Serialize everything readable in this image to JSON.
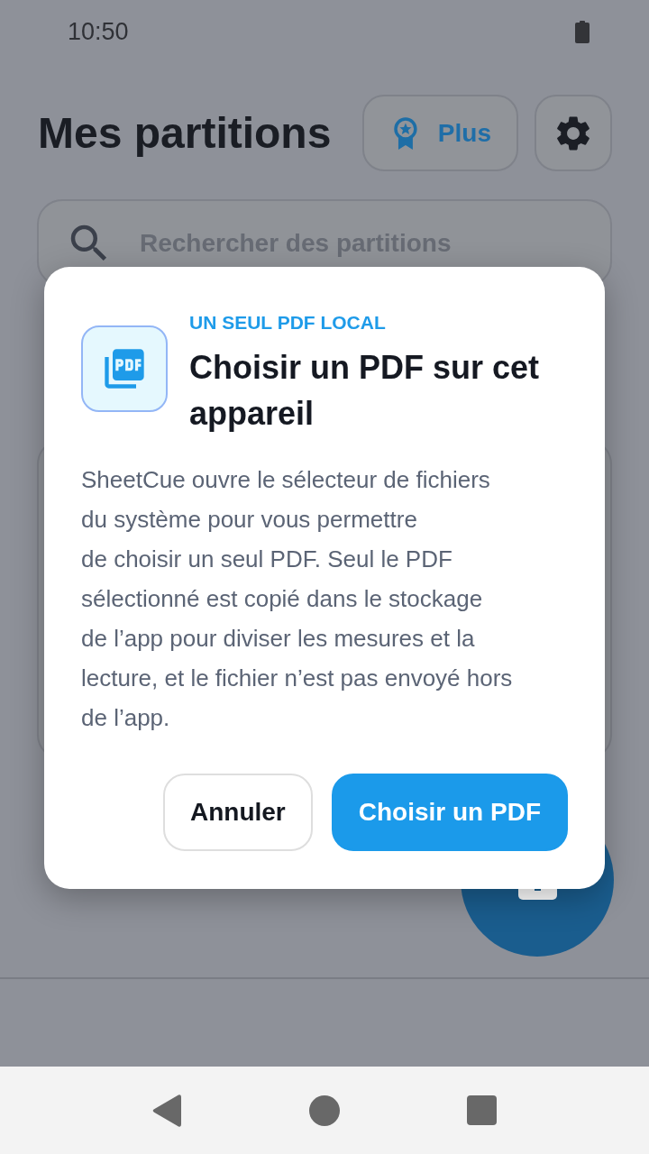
{
  "status_bar": {
    "time": "10:50"
  },
  "header": {
    "title": "Mes partitions",
    "plus_button": {
      "label": "Plus"
    }
  },
  "search": {
    "placeholder": "Rechercher des partitions"
  },
  "dialog": {
    "eyebrow": "UN SEUL PDF LOCAL",
    "title": "Choisir un PDF sur cet appareil",
    "body": "SheetCue ouvre le sélecteur de fichiers\ndu système pour vous permettre\nde choisir un seul PDF. Seul le PDF\nsélectionné est copié dans le stockage\nde l’app pour diviser les mesures et la\nlecture, et le fichier n’est pas envoyé hors\nde l’app.",
    "buttons": [
      {
        "label": "Annuler",
        "kind": "secondary"
      },
      {
        "label": "Choisir un PDF",
        "kind": "primary"
      }
    ]
  }
}
